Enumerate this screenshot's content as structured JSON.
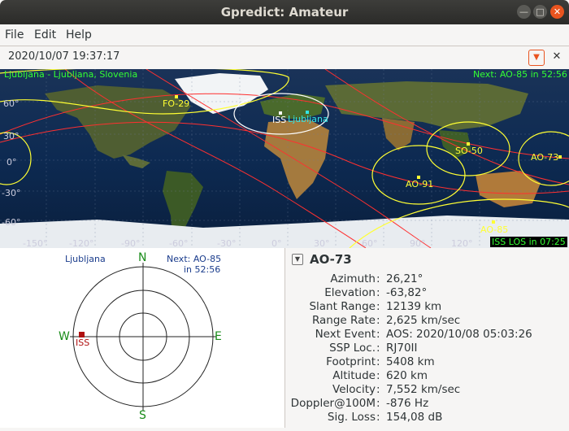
{
  "window": {
    "title": "Gpredict: Amateur"
  },
  "menu": {
    "file": "File",
    "edit": "Edit",
    "help": "Help"
  },
  "timebar": {
    "datetime": "2020/10/07 19:37:17"
  },
  "map": {
    "qth_label": "Ljubljana - Ljubljana, Slovenia",
    "next_label": "Next: AO-85 in 52:56",
    "los_label": "ISS LOS in 07:25",
    "lat_labels": [
      "60°",
      "30°",
      "0°",
      "-30°",
      "-60°"
    ],
    "lon_labels": [
      "-150°",
      "-120°",
      "-90°",
      "-60°",
      "-30°",
      "0°",
      "30°",
      "60°",
      "90°",
      "120°"
    ],
    "satellites": {
      "fo29": "FO-29",
      "iss": "ISS",
      "ljubljana": "Ljubljana",
      "so50": "SO-50",
      "ao73": "AO-73",
      "ao91": "AO-91",
      "ao85": "AO-85"
    }
  },
  "polar": {
    "qth": "Ljubljana",
    "next_line1": "Next: AO-85",
    "next_line2": "in 52:56",
    "n": "N",
    "s": "S",
    "e": "E",
    "w": "W",
    "sat": "ISS"
  },
  "details": {
    "title": "AO-73",
    "rows": [
      {
        "key": "Azimuth",
        "value": "26,21°"
      },
      {
        "key": "Elevation",
        "value": "-63,82°"
      },
      {
        "key": "Slant Range",
        "value": "12139 km"
      },
      {
        "key": "Range Rate",
        "value": "2,625 km/sec"
      },
      {
        "key": "Next Event",
        "value": "AOS: 2020/10/08 05:03:26"
      },
      {
        "key": "SSP Loc.",
        "value": "RJ70II"
      },
      {
        "key": "Footprint",
        "value": "5408 km"
      },
      {
        "key": "Altitude",
        "value": "620 km"
      },
      {
        "key": "Velocity",
        "value": "7,552 km/sec"
      },
      {
        "key": "Doppler@100M",
        "value": "-876 Hz"
      },
      {
        "key": "Sig. Loss",
        "value": "154,08 dB"
      }
    ]
  },
  "colors": {
    "footprint": "#ffff33",
    "iss_footprint": "#ffffff",
    "track": "#ff3030",
    "label_green": "#33ff33",
    "polar_label": "#1a3c8c"
  }
}
